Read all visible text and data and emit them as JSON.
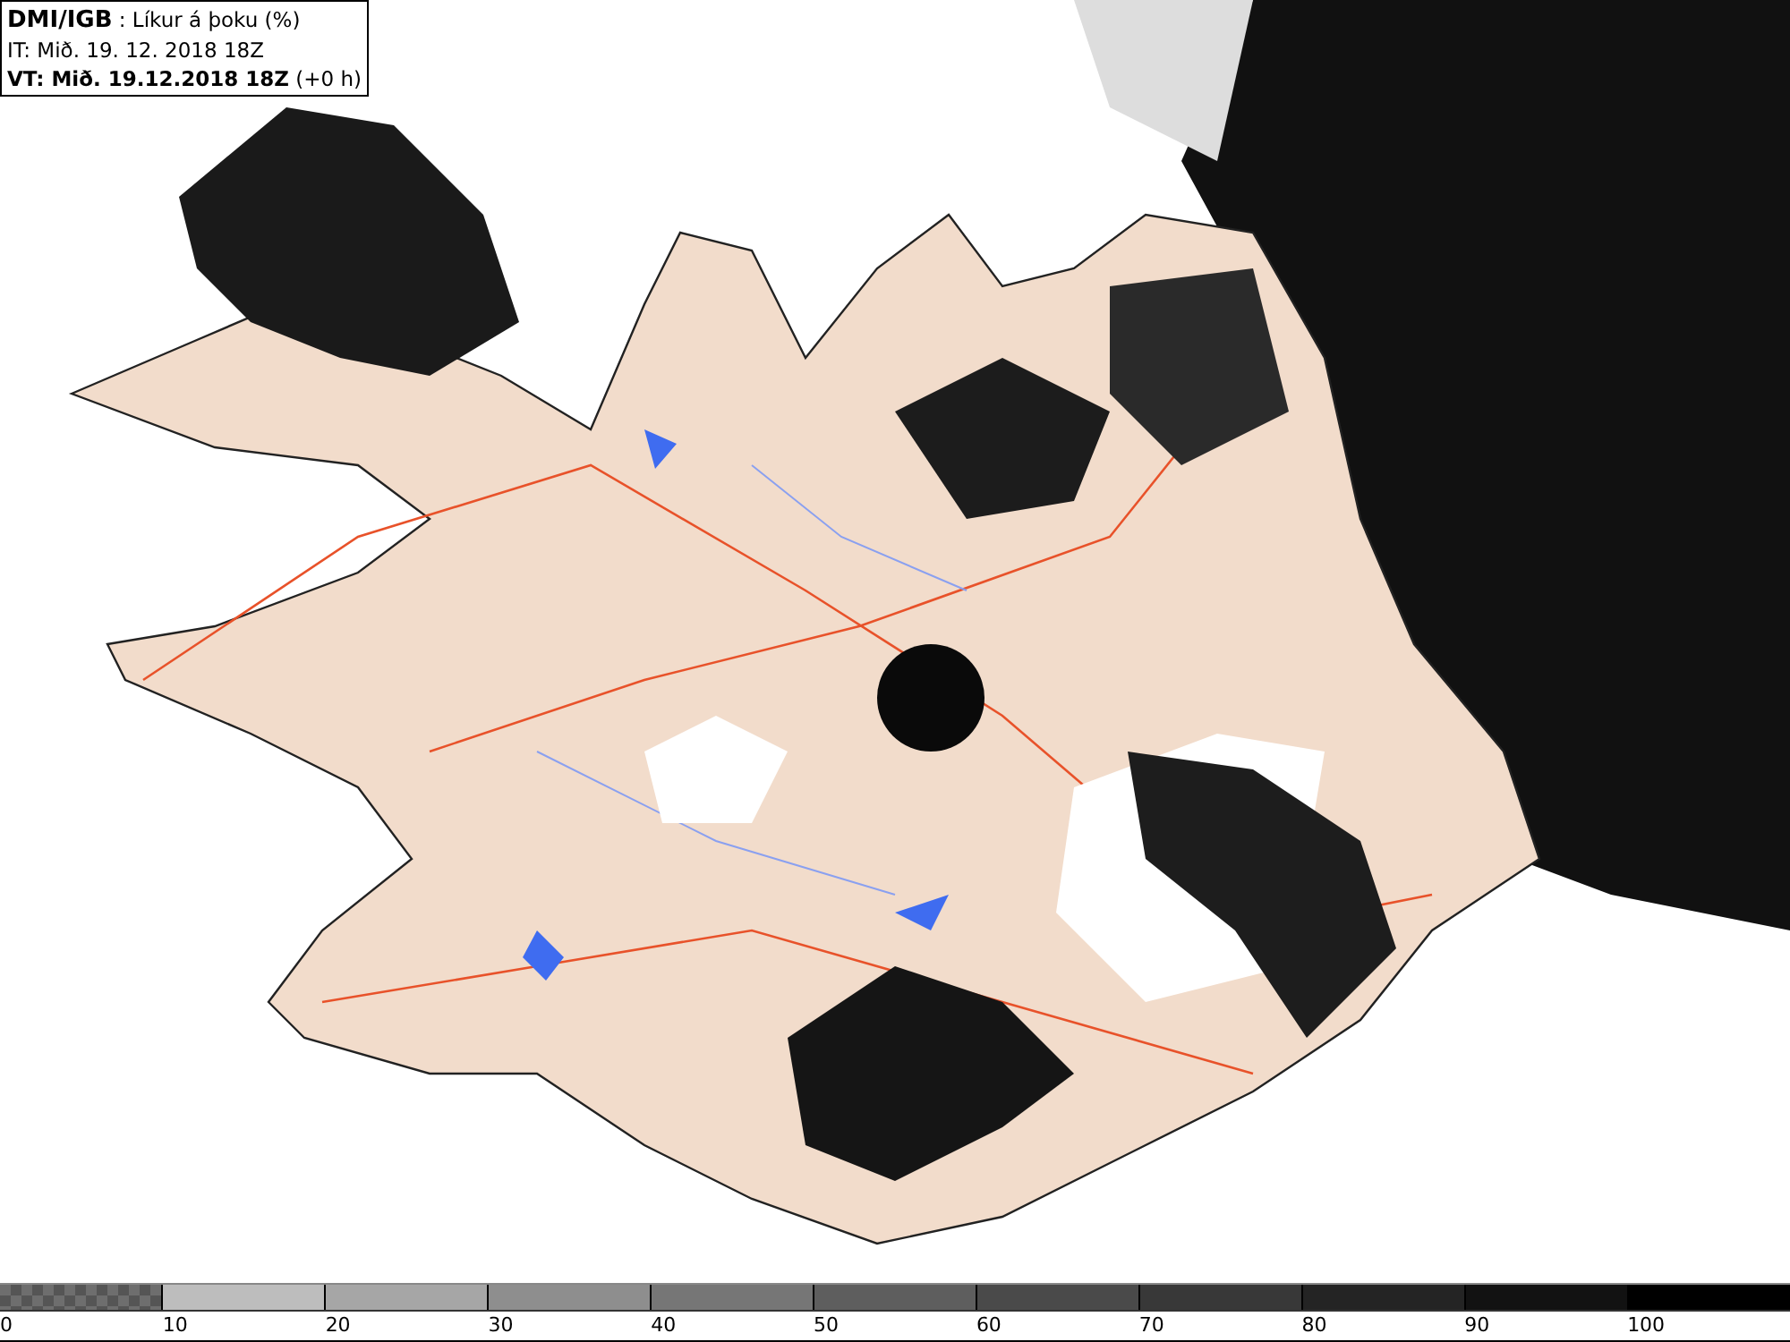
{
  "header": {
    "lines": [
      "**DMI/IGB** : Líkur á þoku (%)",
      "IT: Mið. 19. 12. 2018 18Z",
      "**VT: Mið. 19.12.2018 18Z** (+0 h)"
    ]
  },
  "legend": {
    "items": [
      {
        "label": "0",
        "kind": "checker",
        "color": "#6e6e6e"
      },
      {
        "label": "10",
        "kind": "solid",
        "color": "#bdbdbd"
      },
      {
        "label": "20",
        "kind": "solid",
        "color": "#a6a6a6"
      },
      {
        "label": "30",
        "kind": "solid",
        "color": "#8e8e8e"
      },
      {
        "label": "40",
        "kind": "solid",
        "color": "#767676"
      },
      {
        "label": "50",
        "kind": "solid",
        "color": "#5e5e5e"
      },
      {
        "label": "60",
        "kind": "solid",
        "color": "#4a4a4a"
      },
      {
        "label": "70",
        "kind": "solid",
        "color": "#383838"
      },
      {
        "label": "80",
        "kind": "solid",
        "color": "#242424"
      },
      {
        "label": "90",
        "kind": "solid",
        "color": "#121212"
      },
      {
        "label": "100",
        "kind": "solid",
        "color": "#000000"
      }
    ]
  }
}
